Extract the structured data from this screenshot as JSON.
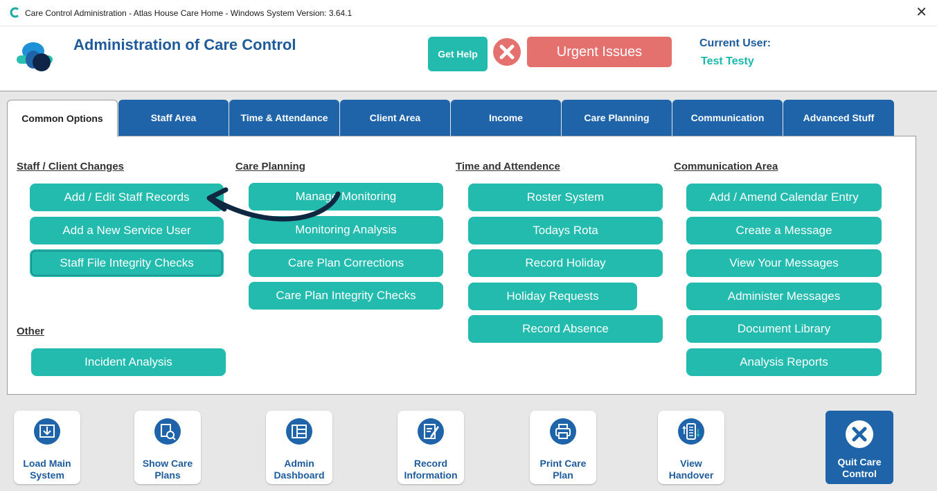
{
  "window": {
    "title": "Care Control Administration - Atlas House Care Home - Windows System Version: 3.64.1",
    "close_glyph": "✕"
  },
  "header": {
    "title": "Administration of Care Control",
    "get_help": "Get Help",
    "urgent": "Urgent Issues",
    "current_user_label": "Current User:",
    "current_user_name": "Test Testy"
  },
  "tabs": [
    {
      "label": "Common Options",
      "active": true
    },
    {
      "label": "Staff Area"
    },
    {
      "label": "Time & Attendance"
    },
    {
      "label": "Client Area"
    },
    {
      "label": "Income"
    },
    {
      "label": "Care Planning"
    },
    {
      "label": "Communication"
    },
    {
      "label": "Advanced Stuff"
    }
  ],
  "sections": {
    "staff_client": {
      "heading": "Staff / Client Changes",
      "buttons": [
        "Add / Edit Staff Records",
        "Add a New Service User",
        "Staff File Integrity Checks"
      ]
    },
    "other": {
      "heading": "Other",
      "buttons": [
        "Incident Analysis"
      ]
    },
    "care_planning": {
      "heading": "Care Planning",
      "buttons": [
        "Manage Monitoring",
        "Monitoring Analysis",
        "Care Plan Corrections",
        "Care Plan Integrity Checks"
      ]
    },
    "time_attendance": {
      "heading": "Time and Attendence",
      "buttons": [
        "Roster System",
        "Todays Rota",
        "Record Holiday",
        "Holiday Requests",
        "Record Absence"
      ]
    },
    "communication": {
      "heading": "Communication Area",
      "buttons": [
        "Add / Amend Calendar Entry",
        "Create a Message",
        "View Your Messages",
        "Administer Messages",
        "Document Library",
        "Analysis Reports"
      ]
    }
  },
  "bottom_bar": [
    {
      "line1": "Load Main",
      "line2": "System",
      "icon": "download-icon"
    },
    {
      "line1": "Show Care",
      "line2": "Plans",
      "icon": "document-search-icon"
    },
    {
      "line1": "Admin",
      "line2": "Dashboard",
      "icon": "dashboard-icon"
    },
    {
      "line1": "Record",
      "line2": "Information",
      "icon": "edit-document-icon"
    },
    {
      "line1": "Print Care",
      "line2": "Plan",
      "icon": "printer-icon"
    },
    {
      "line1": "View",
      "line2": "Handover",
      "icon": "handover-icon"
    }
  ],
  "quit": {
    "line1": "Quit Care",
    "line2": "Control"
  },
  "colors": {
    "teal": "#22bbae",
    "navy": "#1f63a8",
    "urgent": "#e5716e",
    "title_blue": "#1f5a9a",
    "arrow": "#0f2740"
  }
}
